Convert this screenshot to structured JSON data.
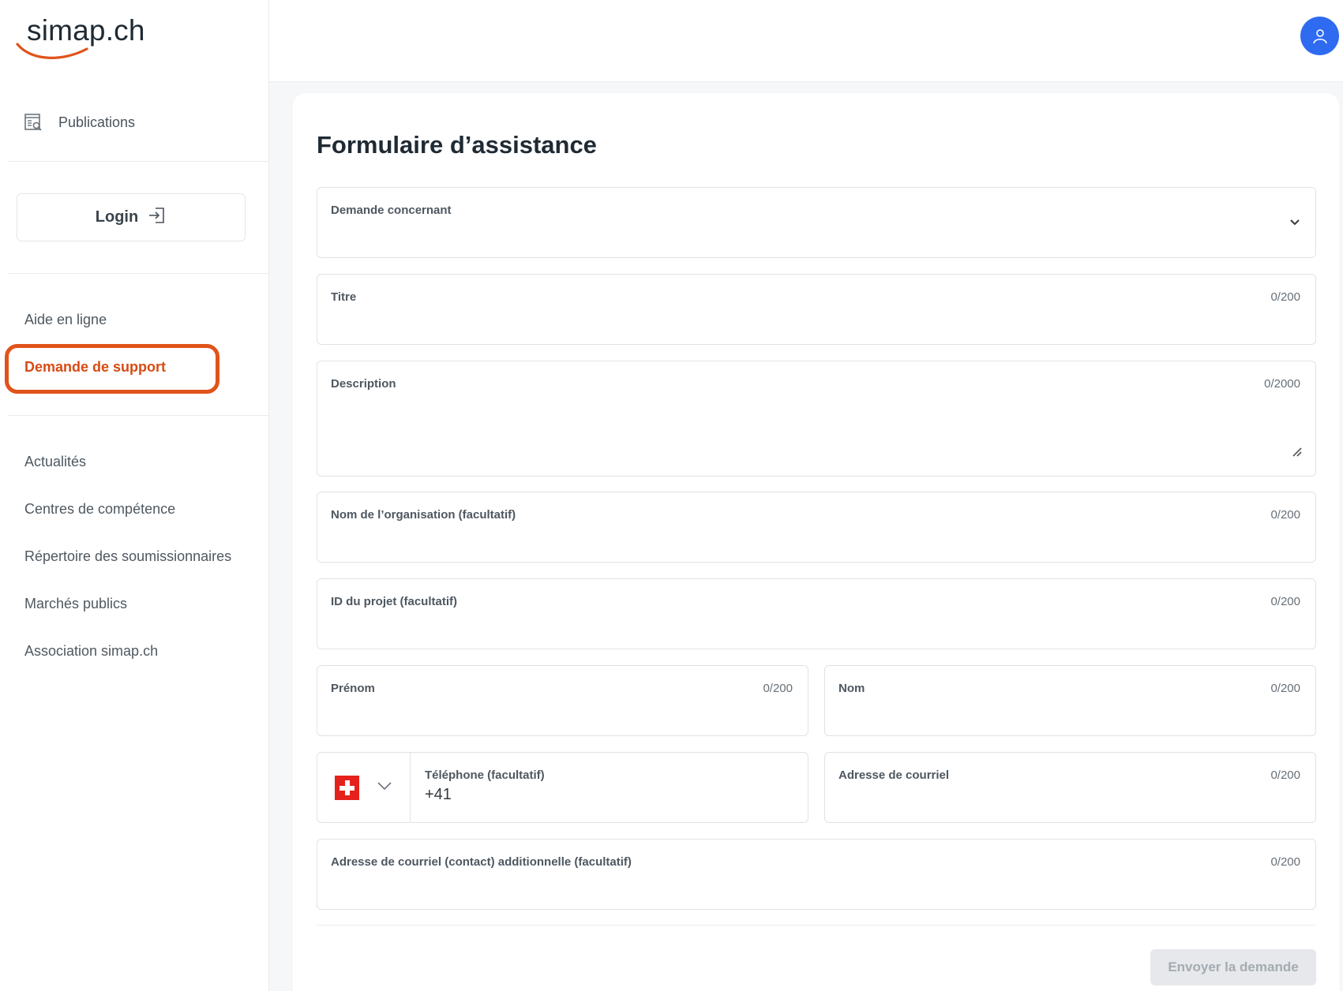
{
  "logo": {
    "text": "simap.ch"
  },
  "sidebar": {
    "publications_label": "Publications",
    "login_label": "Login",
    "help_label": "Aide en ligne",
    "support_label": "Demande de support",
    "links": [
      "Actualités",
      "Centres de compétence",
      "Répertoire des soumissionnaires",
      "Marchés publics",
      "Association simap.ch"
    ]
  },
  "form": {
    "title": "Formulaire d’assistance",
    "fields": {
      "subject": {
        "label": "Demande concernant"
      },
      "title": {
        "label": "Titre",
        "counter": "0/200"
      },
      "description": {
        "label": "Description",
        "counter": "0/2000"
      },
      "organisation": {
        "label": "Nom de l’organisation (facultatif)",
        "counter": "0/200"
      },
      "project_id": {
        "label": "ID du projet (facultatif)",
        "counter": "0/200"
      },
      "first_name": {
        "label": "Prénom",
        "counter": "0/200"
      },
      "last_name": {
        "label": "Nom",
        "counter": "0/200"
      },
      "phone": {
        "label": "Téléphone (facultatif)",
        "value": "+41"
      },
      "email": {
        "label": "Adresse de courriel",
        "counter": "0/200"
      },
      "extra_email": {
        "label": "Adresse de courriel (contact) additionnelle (facultatif)",
        "counter": "0/200"
      }
    },
    "submit_label": "Envoyer la demande"
  },
  "colors": {
    "accent": "#d74b14",
    "highlight_ring": "#e0531b",
    "avatar": "#2f6bf0",
    "flag_red": "#e5211c"
  },
  "icons": [
    "publications-icon",
    "login-icon",
    "user-icon",
    "chevron-down-icon",
    "resize-handle-icon",
    "swiss-flag-icon"
  ]
}
